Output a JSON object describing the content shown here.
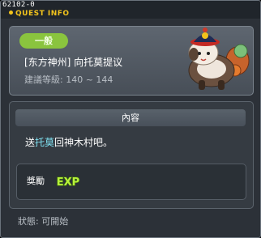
{
  "window": {
    "quest_id": "62102-0",
    "title": "QUEST INFO"
  },
  "quest": {
    "category_tag": "一般",
    "name": "[东方神州] 向托莫提议",
    "level_range": "建議等級: 140 ~ 144"
  },
  "content": {
    "section_title": "內容",
    "description_before": "送",
    "description_highlight": "托莫",
    "description_after": "回神木村吧。"
  },
  "reward": {
    "label": "獎勵",
    "icon": "exp-icon",
    "icon_text": "EXP"
  },
  "status": {
    "text": "狀態: 可開始"
  },
  "colors": {
    "title_yellow": "#f2c31c",
    "tag_green": "#8ac43e",
    "highlight_cyan": "#7fe0f0",
    "exp_green": "#b6f03a"
  }
}
